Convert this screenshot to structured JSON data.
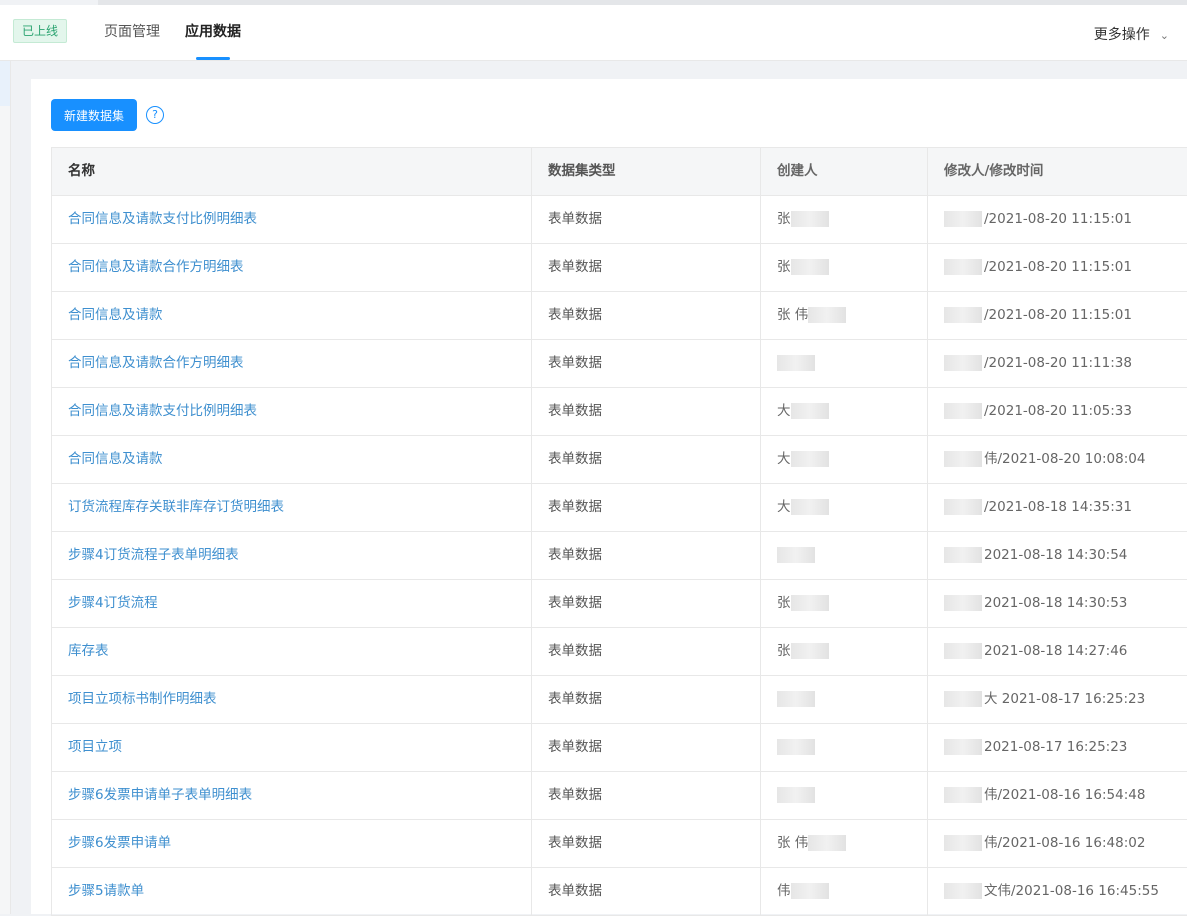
{
  "header": {
    "status_badge": "已上线",
    "tabs": [
      {
        "label": "页面管理"
      },
      {
        "label": "应用数据"
      }
    ],
    "more_label": "更多操作"
  },
  "toolbar": {
    "new_dataset_label": "新建数据集",
    "help_glyph": "?"
  },
  "table": {
    "columns": [
      "名称",
      "数据集类型",
      "创建人",
      "修改人/修改时间"
    ],
    "rows": [
      {
        "name": "合同信息及请款支付比例明细表",
        "type": "表单数据",
        "creator": "张",
        "modified": "/2021-08-20 11:15:01"
      },
      {
        "name": "合同信息及请款合作方明细表",
        "type": "表单数据",
        "creator": "张",
        "modified": "/2021-08-20 11:15:01"
      },
      {
        "name": "合同信息及请款",
        "type": "表单数据",
        "creator": "张 伟",
        "modified": "/2021-08-20 11:15:01"
      },
      {
        "name": "合同信息及请款合作方明细表",
        "type": "表单数据",
        "creator": "",
        "modified": "/2021-08-20 11:11:38"
      },
      {
        "name": "合同信息及请款支付比例明细表",
        "type": "表单数据",
        "creator": "大",
        "modified": "/2021-08-20 11:05:33"
      },
      {
        "name": "合同信息及请款",
        "type": "表单数据",
        "creator": "大",
        "modified": "伟/2021-08-20 10:08:04"
      },
      {
        "name": "订货流程库存关联非库存订货明细表",
        "type": "表单数据",
        "creator": "大",
        "modified": "/2021-08-18 14:35:31"
      },
      {
        "name": "步骤4订货流程子表单明细表",
        "type": "表单数据",
        "creator": "",
        "modified": "2021-08-18 14:30:54"
      },
      {
        "name": "步骤4订货流程",
        "type": "表单数据",
        "creator": "张",
        "modified": "2021-08-18 14:30:53"
      },
      {
        "name": "库存表",
        "type": "表单数据",
        "creator": "张",
        "modified": "2021-08-18 14:27:46"
      },
      {
        "name": "项目立项标书制作明细表",
        "type": "表单数据",
        "creator": "",
        "modified": "大 2021-08-17 16:25:23"
      },
      {
        "name": "项目立项",
        "type": "表单数据",
        "creator": "",
        "modified": "2021-08-17 16:25:23"
      },
      {
        "name": "步骤6发票申请单子表单明细表",
        "type": "表单数据",
        "creator": "",
        "modified": "伟/2021-08-16 16:54:48"
      },
      {
        "name": "步骤6发票申请单",
        "type": "表单数据",
        "creator": "张 伟",
        "modified": "伟/2021-08-16 16:48:02"
      },
      {
        "name": "步骤5请款单",
        "type": "表单数据",
        "creator": "伟",
        "modified": "文伟/2021-08-16 16:45:55"
      }
    ]
  },
  "colors": {
    "primary": "#1890ff",
    "link": "#3e8fcf",
    "badge_text": "#2ba471",
    "badge_bg": "#e3f6ec"
  },
  "icons": {
    "more_chevron": "chevron-down-icon",
    "help": "help-circle-icon"
  }
}
